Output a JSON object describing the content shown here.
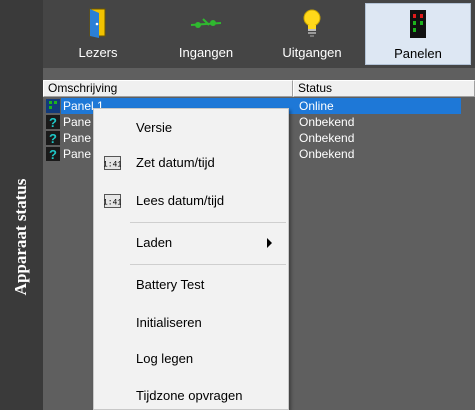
{
  "sidebar": {
    "title": "Apparaat status"
  },
  "toolbar": {
    "items": [
      {
        "label": "Lezers",
        "icon": "door-reader-icon"
      },
      {
        "label": "Ingangen",
        "icon": "input-connector-icon"
      },
      {
        "label": "Uitgangen",
        "icon": "lightbulb-icon"
      },
      {
        "label": "Panelen",
        "icon": "panel-leds-icon",
        "active": true
      }
    ]
  },
  "grid": {
    "columns": [
      "Omschrijving",
      "Status"
    ],
    "rows": [
      {
        "name": "Panel 1",
        "status": "Online",
        "selected": true
      },
      {
        "name": "Pane",
        "status": "Onbekend"
      },
      {
        "name": "Pane",
        "status": "Onbekend"
      },
      {
        "name": "Pane",
        "status": "Onbekend"
      }
    ]
  },
  "context_menu": {
    "items": [
      {
        "label": "Versie"
      },
      {
        "label": "Zet datum/tijd",
        "icon": "clock-display-icon"
      },
      {
        "label": "Lees datum/tijd",
        "icon": "clock-display-icon"
      },
      {
        "label": "Laden",
        "submenu": true
      },
      {
        "label": "Battery Test"
      },
      {
        "label": "Initialiseren"
      },
      {
        "label": "Log legen"
      },
      {
        "label": "Tijdzone opvragen"
      }
    ]
  },
  "colors": {
    "selection": "#1e78d7",
    "active_tab": "#dde7f3",
    "toolbar": "#454545",
    "background": "#5f5f5f"
  }
}
